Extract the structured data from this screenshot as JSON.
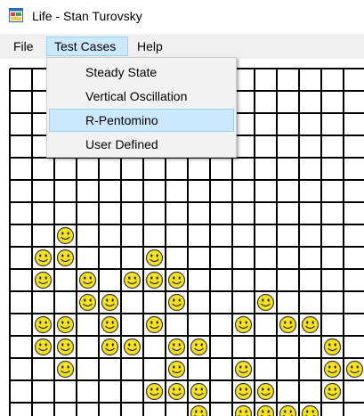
{
  "window": {
    "title": "Life - Stan Turovsky",
    "icon": "app-window-icon"
  },
  "menubar": {
    "items": [
      {
        "label": "File"
      },
      {
        "label": "Test Cases"
      },
      {
        "label": "Help"
      }
    ],
    "open_index": 1
  },
  "dropdown": {
    "items": [
      {
        "label": "Steady State"
      },
      {
        "label": "Vertical Oscillation"
      },
      {
        "label": "R-Pentomino"
      },
      {
        "label": "User Defined"
      }
    ],
    "highlighted_index": 2
  },
  "colors": {
    "menubar_bg": "#f0f0f0",
    "highlight_bg": "#cce8ff",
    "highlight_border": "#99d1ff",
    "grid_line": "#000000",
    "cell_fill": "#f7e21f"
  },
  "grid": {
    "cell_icon": "smiley-icon",
    "live_cells": [
      [
        7,
        2
      ],
      [
        8,
        1
      ],
      [
        8,
        2
      ],
      [
        8,
        6
      ],
      [
        9,
        1
      ],
      [
        9,
        3
      ],
      [
        9,
        5
      ],
      [
        9,
        6
      ],
      [
        9,
        7
      ],
      [
        10,
        3
      ],
      [
        10,
        4
      ],
      [
        10,
        7
      ],
      [
        10,
        11
      ],
      [
        11,
        1
      ],
      [
        11,
        2
      ],
      [
        11,
        4
      ],
      [
        11,
        6
      ],
      [
        11,
        10
      ],
      [
        11,
        12
      ],
      [
        11,
        13
      ],
      [
        12,
        1
      ],
      [
        12,
        2
      ],
      [
        12,
        4
      ],
      [
        12,
        5
      ],
      [
        12,
        7
      ],
      [
        12,
        8
      ],
      [
        12,
        14
      ],
      [
        13,
        2
      ],
      [
        13,
        7
      ],
      [
        13,
        10
      ],
      [
        13,
        14
      ],
      [
        13,
        15
      ],
      [
        14,
        6
      ],
      [
        14,
        7
      ],
      [
        14,
        8
      ],
      [
        14,
        10
      ],
      [
        14,
        11
      ],
      [
        14,
        14
      ],
      [
        15,
        8
      ],
      [
        15,
        10
      ],
      [
        15,
        11
      ],
      [
        15,
        12
      ],
      [
        15,
        13
      ]
    ]
  }
}
